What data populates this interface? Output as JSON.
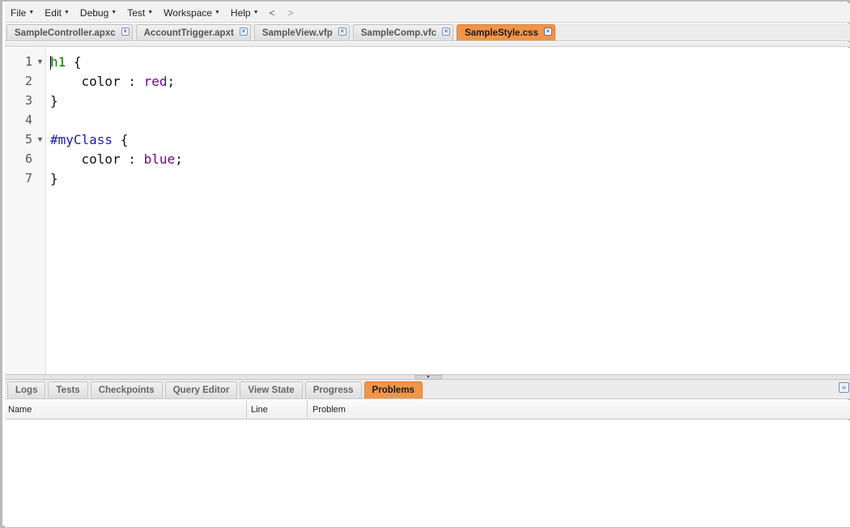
{
  "menubar": {
    "items": [
      {
        "label": "File"
      },
      {
        "label": "Edit"
      },
      {
        "label": "Debug"
      },
      {
        "label": "Test"
      },
      {
        "label": "Workspace"
      },
      {
        "label": "Help"
      }
    ],
    "back_label": "<",
    "forward_label": ">"
  },
  "editor_tabs": [
    {
      "label": "SampleController.apxc",
      "active": false
    },
    {
      "label": "AccountTrigger.apxt",
      "active": false
    },
    {
      "label": "SampleView.vfp",
      "active": false
    },
    {
      "label": "SampleComp.vfc",
      "active": false
    },
    {
      "label": "SampleStyle.css",
      "active": true
    }
  ],
  "tab_close_glyph": "×",
  "editor": {
    "lines": [
      {
        "n": "1",
        "fold": "▼"
      },
      {
        "n": "2",
        "fold": ""
      },
      {
        "n": "3",
        "fold": ""
      },
      {
        "n": "4",
        "fold": ""
      },
      {
        "n": "5",
        "fold": "▼"
      },
      {
        "n": "6",
        "fold": ""
      },
      {
        "n": "7",
        "fold": ""
      }
    ],
    "code": {
      "l1_selector": "h1",
      "l1_brace": " {",
      "l2_prop": "    color : ",
      "l2_value": "red",
      "l2_end": ";",
      "l3": "}",
      "l4": "",
      "l5_selector": "#myClass",
      "l5_brace": " {",
      "l6_prop": "    color : ",
      "l6_value": "blue",
      "l6_end": ";",
      "l7": "}"
    }
  },
  "splitter_glyph": "▾",
  "bottom_tabs": [
    {
      "label": "Logs",
      "active": false
    },
    {
      "label": "Tests",
      "active": false
    },
    {
      "label": "Checkpoints",
      "active": false
    },
    {
      "label": "Query Editor",
      "active": false
    },
    {
      "label": "View State",
      "active": false
    },
    {
      "label": "Progress",
      "active": false
    },
    {
      "label": "Problems",
      "active": true
    }
  ],
  "collapse_glyph": "»",
  "problems": {
    "columns": {
      "name": "Name",
      "line": "Line",
      "problem": "Problem"
    }
  },
  "colors": {
    "active_tab": "#f0954a",
    "selector": "#117700",
    "id_selector": "#1a1aa6",
    "value": "#770088"
  },
  "icons": {
    "tab_close": "close-icon",
    "fold": "fold-arrow-icon",
    "collapse_panel": "collapse-icon",
    "menu_caret": "caret-down-icon"
  }
}
